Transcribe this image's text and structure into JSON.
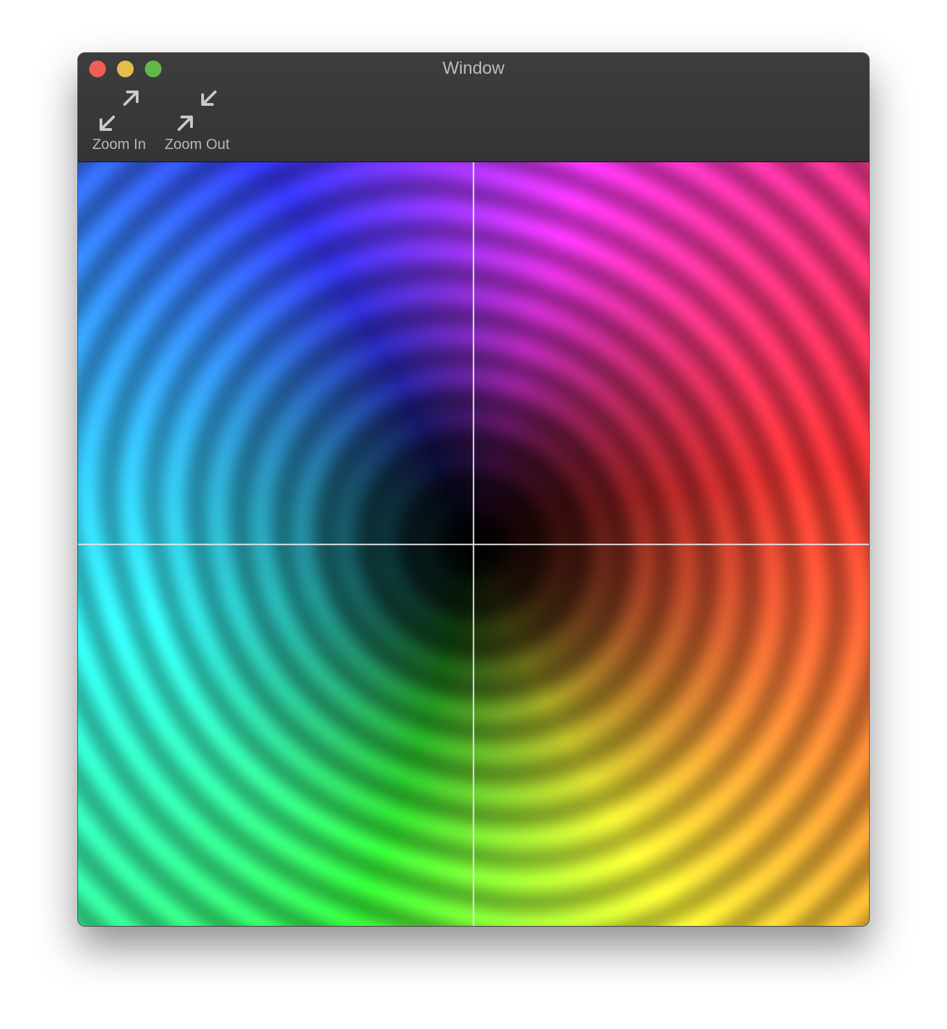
{
  "window": {
    "title": "Window"
  },
  "toolbar": {
    "zoom_in_label": "Zoom In",
    "zoom_out_label": "Zoom Out",
    "zoom_in_icon": "expand-arrows-icon",
    "zoom_out_icon": "contract-arrows-icon"
  },
  "colors": {
    "close": "#ee5f57",
    "minimize": "#e5bd4a",
    "maximize": "#62b846",
    "toolbar_bg": "#3a3a3a",
    "axis": "#e6e6e6"
  }
}
